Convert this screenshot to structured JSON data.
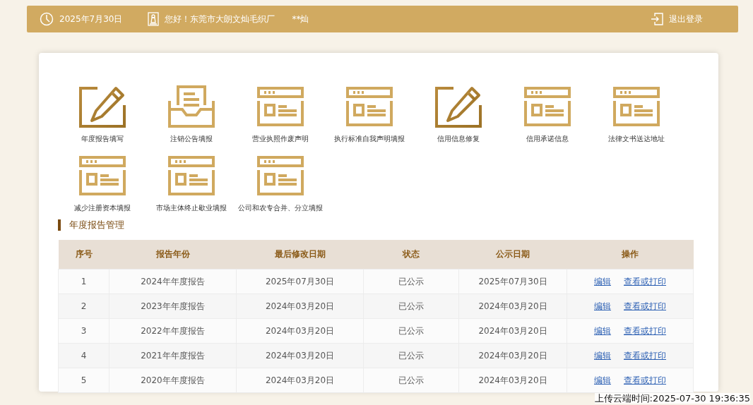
{
  "header": {
    "date": "2025年7月30日",
    "greeting": "您好！东莞市大朗文灿毛织厂",
    "user": "**灿",
    "logout": "退出登录"
  },
  "services": [
    {
      "label": "年度报告填写",
      "kind": "pencil"
    },
    {
      "label": "注销公告填报",
      "kind": "inbox"
    },
    {
      "label": "营业执照作废声明",
      "kind": "form"
    },
    {
      "label": "执行标准自我声明填报",
      "kind": "form"
    },
    {
      "label": "信用信息修复",
      "kind": "pencil"
    },
    {
      "label": "信用承诺信息",
      "kind": "form"
    },
    {
      "label": "法律文书送达地址",
      "kind": "form"
    },
    {
      "label": "减少注册资本填报",
      "kind": "form"
    },
    {
      "label": "市场主体终止歇业填报",
      "kind": "form"
    },
    {
      "label": "公司和农专合并、分立填报",
      "kind": "form"
    }
  ],
  "section_title": "年度报告管理",
  "table": {
    "columns": [
      "序号",
      "报告年份",
      "最后修改日期",
      "状态",
      "公示日期",
      "操作"
    ],
    "rows": [
      {
        "cells": [
          "1",
          "2024年年度报告",
          "2025年07月30日",
          "已公示",
          "2025年07月30日"
        ],
        "actions": [
          "编辑",
          "查看或打印"
        ]
      },
      {
        "cells": [
          "2",
          "2023年年度报告",
          "2024年03月20日",
          "已公示",
          "2024年03月20日"
        ],
        "actions": [
          "编辑",
          "查看或打印"
        ]
      },
      {
        "cells": [
          "3",
          "2022年年度报告",
          "2024年03月20日",
          "已公示",
          "2024年03月20日"
        ],
        "actions": [
          "编辑",
          "查看或打印"
        ]
      },
      {
        "cells": [
          "4",
          "2021年年度报告",
          "2024年03月20日",
          "已公示",
          "2024年03月20日"
        ],
        "actions": [
          "编辑",
          "查看或打印"
        ]
      },
      {
        "cells": [
          "5",
          "2020年年度报告",
          "2024年03月20日",
          "已公示",
          "2024年03月20日"
        ],
        "actions": [
          "编辑",
          "查看或打印"
        ]
      }
    ]
  },
  "upload_stamp": "上传云端时间:2025-07-30 19:36:35"
}
